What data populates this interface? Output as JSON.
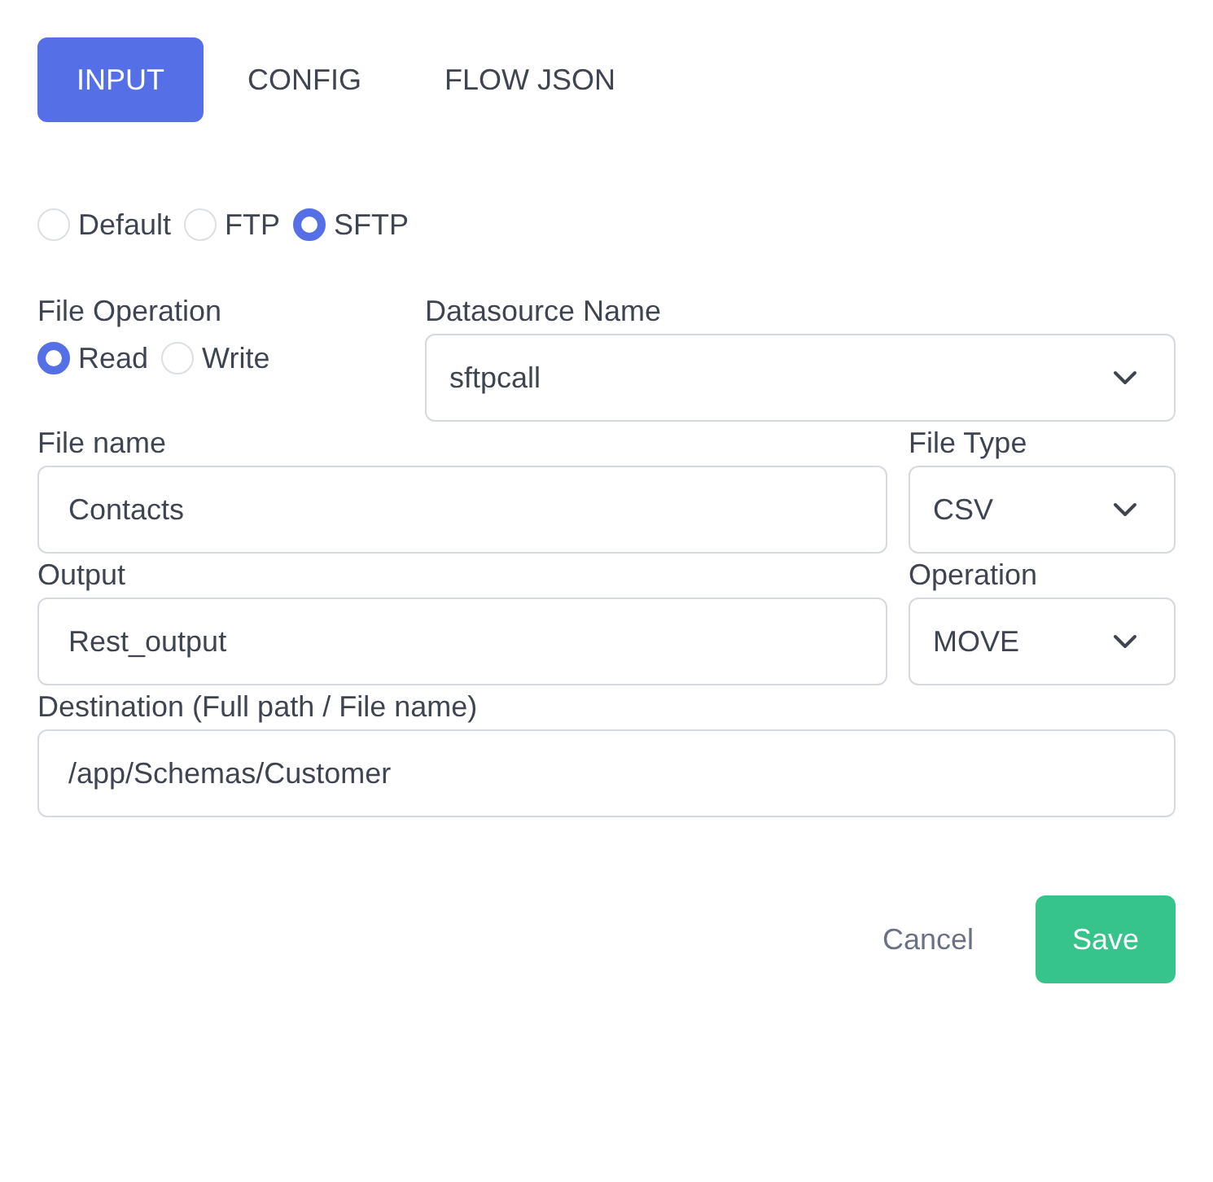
{
  "tabs": [
    {
      "label": "INPUT",
      "selected": true
    },
    {
      "label": "CONFIG",
      "selected": false
    },
    {
      "label": "FLOW JSON",
      "selected": false
    }
  ],
  "connection_types": [
    {
      "label": "Default",
      "selected": false
    },
    {
      "label": "FTP",
      "selected": false
    },
    {
      "label": "SFTP",
      "selected": true
    }
  ],
  "file_operation": {
    "label": "File Operation",
    "options": [
      {
        "label": "Read",
        "selected": true
      },
      {
        "label": "Write",
        "selected": false
      }
    ]
  },
  "datasource": {
    "label": "Datasource Name",
    "value": "sftpcall"
  },
  "file_name": {
    "label": "File name",
    "value": "Contacts"
  },
  "file_type": {
    "label": "File Type",
    "value": "CSV"
  },
  "output": {
    "label": "Output",
    "value": "Rest_output"
  },
  "operation": {
    "label": "Operation",
    "value": "MOVE"
  },
  "destination": {
    "label": "Destination (Full path / File name)",
    "value": "/app/Schemas/Customer"
  },
  "buttons": [
    {
      "label": "Cancel",
      "kind": "secondary"
    },
    {
      "label": "Save",
      "kind": "primary"
    }
  ]
}
